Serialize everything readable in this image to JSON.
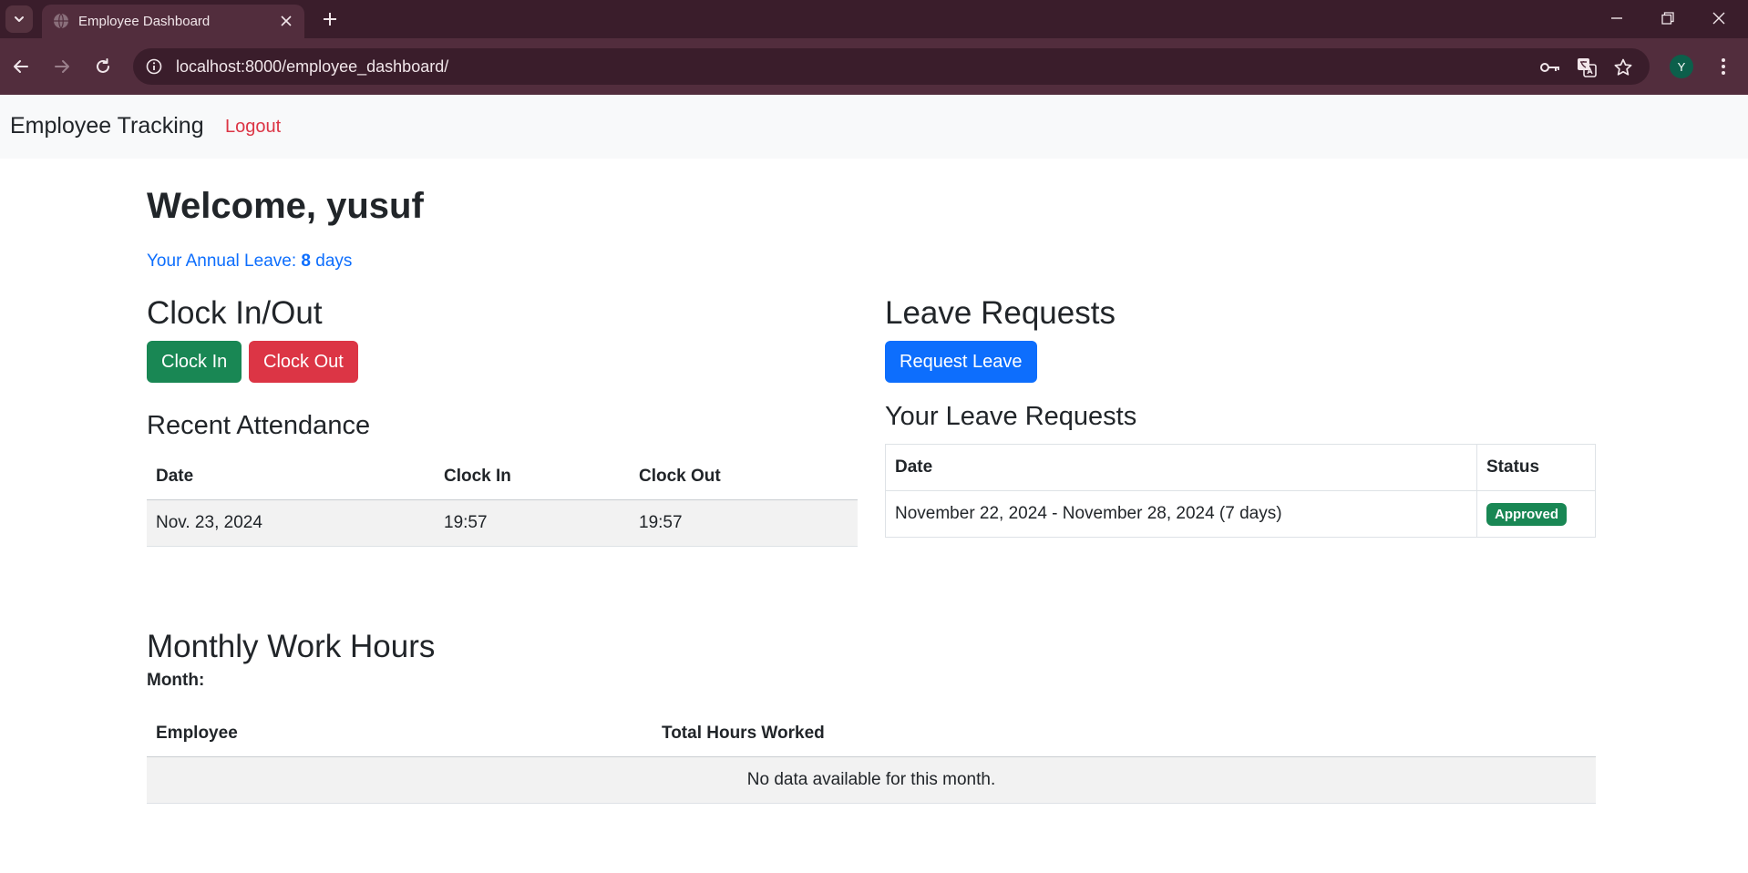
{
  "browser": {
    "tab_title": "Employee Dashboard",
    "url": "localhost:8000/employee_dashboard/",
    "profile_initial": "Y",
    "theme_colors": {
      "tabstrip": "#3a1d2b",
      "toolbar": "#522d3d"
    }
  },
  "navbar": {
    "brand": "Employee Tracking",
    "logout": "Logout"
  },
  "welcome": {
    "title": "Welcome, yusuf",
    "leave_prefix": "Your Annual Leave: ",
    "leave_days": "8",
    "leave_suffix": " days"
  },
  "clock": {
    "title": "Clock In/Out",
    "clock_in_label": "Clock In",
    "clock_out_label": "Clock Out"
  },
  "attendance": {
    "title": "Recent Attendance",
    "columns": [
      "Date",
      "Clock In",
      "Clock Out"
    ],
    "rows": [
      [
        "Nov. 23, 2024",
        "19:57",
        "19:57"
      ]
    ]
  },
  "leave": {
    "title": "Leave Requests",
    "request_label": "Request Leave",
    "your_requests_title": "Your Leave Requests",
    "columns": [
      "Date",
      "Status"
    ],
    "rows": [
      {
        "date": "November 22, 2024 - November 28, 2024 (7 days)",
        "status": "Approved"
      }
    ]
  },
  "monthly": {
    "title": "Monthly Work Hours",
    "month_label": "Month:",
    "columns": [
      "Employee",
      "Total Hours Worked"
    ],
    "empty_message": "No data available for this month."
  },
  "colors": {
    "success": "#198754",
    "danger": "#dc3545",
    "primary": "#0d6efd",
    "navbar_bg": "#f8f9fa"
  },
  "icons": [
    "chevron-down-icon",
    "globe-icon",
    "close-icon",
    "plus-icon",
    "minimize-icon",
    "restore-icon",
    "back-arrow-icon",
    "forward-arrow-icon",
    "reload-icon",
    "site-info-icon",
    "key-icon",
    "translate-icon",
    "star-icon",
    "kebab-menu-icon"
  ]
}
